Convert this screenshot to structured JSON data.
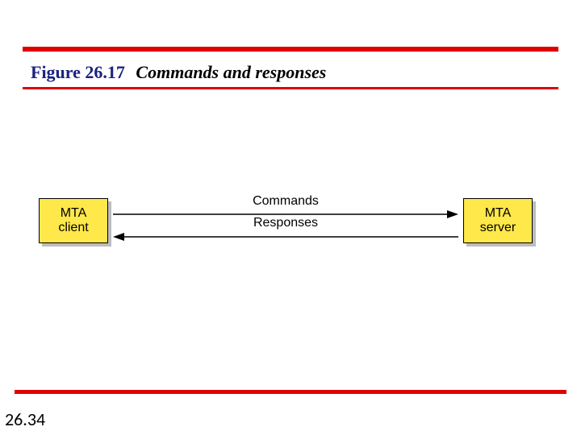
{
  "figure": {
    "label": "Figure 26.17",
    "caption": "Commands and responses"
  },
  "diagram": {
    "left_box": {
      "line1": "MTA",
      "line2": "client"
    },
    "right_box": {
      "line1": "MTA",
      "line2": "server"
    },
    "top_arrow_label": "Commands",
    "bottom_arrow_label": "Responses"
  },
  "page_number": "26.34",
  "chart_data": {
    "type": "diagram",
    "nodes": [
      {
        "id": "mta-client",
        "label": "MTA client"
      },
      {
        "id": "mta-server",
        "label": "MTA server"
      }
    ],
    "edges": [
      {
        "from": "mta-client",
        "to": "mta-server",
        "label": "Commands"
      },
      {
        "from": "mta-server",
        "to": "mta-client",
        "label": "Responses"
      }
    ],
    "title": "Commands and responses"
  },
  "colors": {
    "accent_red": "#e00000",
    "box_fill": "#ffe84a",
    "title_blue": "#1a237e"
  }
}
